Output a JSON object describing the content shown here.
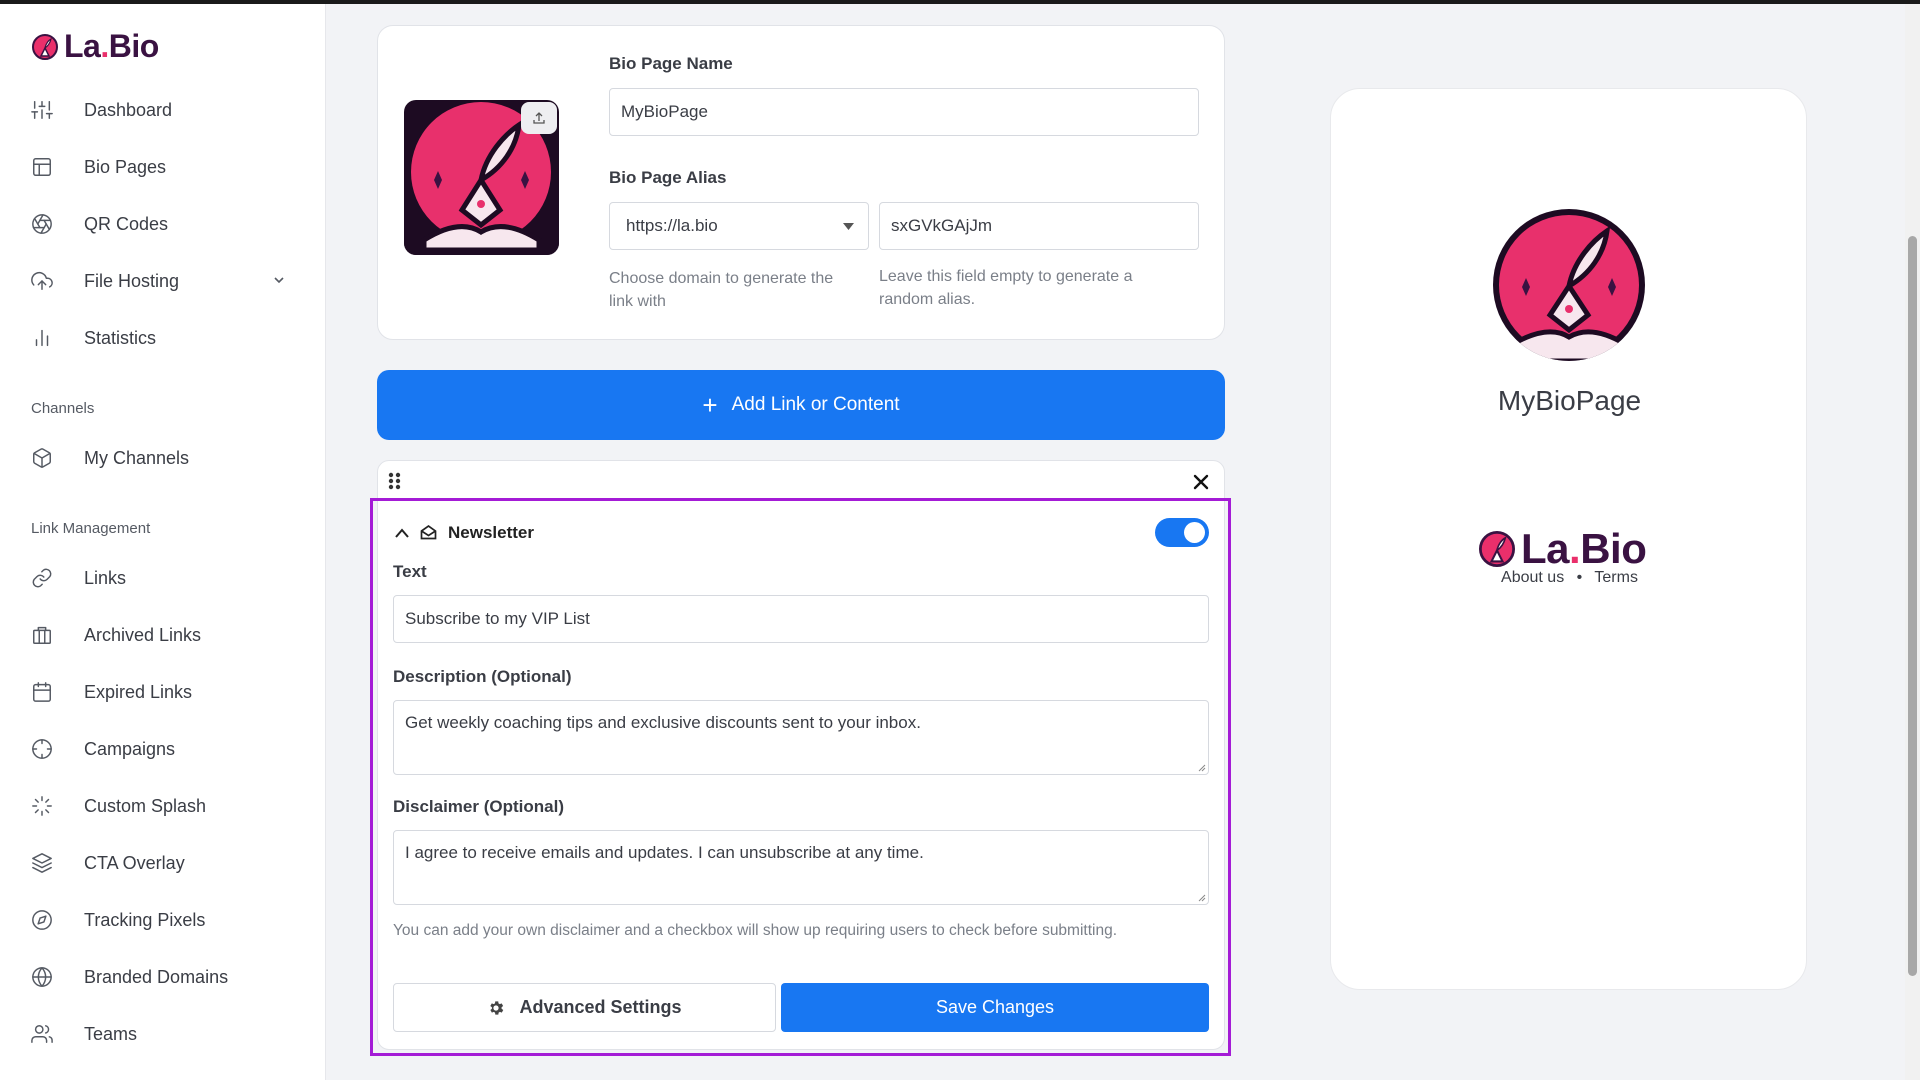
{
  "app": {
    "brand_prefix": "La",
    "brand_dot": ".",
    "brand_suffix": "Bio"
  },
  "sidebar": {
    "items": [
      {
        "label": "Dashboard",
        "icon": "sliders-icon"
      },
      {
        "label": "Bio Pages",
        "icon": "layout-icon"
      },
      {
        "label": "QR Codes",
        "icon": "aperture-icon"
      },
      {
        "label": "File Hosting",
        "icon": "upload-cloud-icon"
      },
      {
        "label": "Statistics",
        "icon": "bar-chart-icon"
      }
    ],
    "channels_heading": "Channels",
    "channels": [
      {
        "label": "My Channels",
        "icon": "box-icon"
      }
    ],
    "link_heading": "Link Management",
    "links": [
      {
        "label": "Links",
        "icon": "link-icon"
      },
      {
        "label": "Archived Links",
        "icon": "archive-icon"
      },
      {
        "label": "Expired Links",
        "icon": "calendar-icon"
      },
      {
        "label": "Campaigns",
        "icon": "crosshair-icon"
      },
      {
        "label": "Custom Splash",
        "icon": "loader-icon"
      },
      {
        "label": "CTA Overlay",
        "icon": "layers-icon"
      },
      {
        "label": "Tracking Pixels",
        "icon": "compass-icon"
      },
      {
        "label": "Branded Domains",
        "icon": "globe-icon"
      },
      {
        "label": "Teams",
        "icon": "users-icon"
      }
    ]
  },
  "bio": {
    "name_label": "Bio Page Name",
    "name_value": "MyBioPage",
    "alias_label": "Bio Page Alias",
    "domain_value": "https://la.bio",
    "alias_value": "sxGVkGAjJm",
    "domain_hint": "Choose domain to generate the link with",
    "alias_hint": "Leave this field empty to generate a random alias."
  },
  "add_button": "Add Link or Content",
  "block": {
    "title": "Newsletter",
    "enabled": true,
    "text_label": "Text",
    "text_value": "Subscribe to my VIP List",
    "desc_label": "Description (Optional)",
    "desc_value": "Get weekly coaching tips and exclusive discounts sent to your inbox.",
    "disclaimer_label": "Disclaimer (Optional)",
    "disclaimer_value": "I agree to receive emails and updates. I can unsubscribe at any time.",
    "disclaimer_hint": "You can add your own disclaimer and a checkbox will show up requiring users to check before submitting.",
    "advanced_label": "Advanced Settings",
    "save_label": "Save Changes"
  },
  "preview": {
    "page_name": "MyBioPage",
    "footer_about": "About us",
    "footer_sep": "•",
    "footer_terms": "Terms"
  },
  "colors": {
    "accent": "#1877f2",
    "brand_pink": "#ea2f6b",
    "brand_dark": "#3a1242",
    "highlight": "#a41bd6"
  }
}
